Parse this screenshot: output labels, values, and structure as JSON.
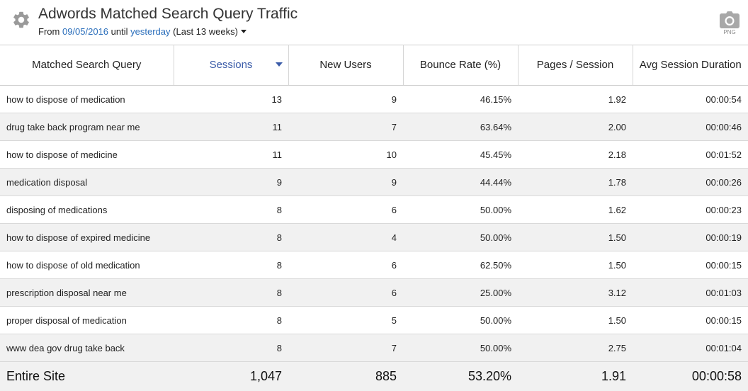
{
  "header": {
    "title": "Adwords Matched Search Query Traffic",
    "from_label": "From",
    "start_date": "09/05/2016",
    "until_label": "until",
    "end_date": "yesterday",
    "period": "(Last 13 weeks)",
    "export_label": "PNG"
  },
  "icons": {
    "settings": "gear-icon",
    "export": "camera-icon",
    "sort": "sort-desc-icon",
    "period": "caret-down-icon"
  },
  "colors": {
    "link": "#2a6ebb",
    "sorted_header": "#3a5ba8",
    "row_alt": "#f1f1f1"
  },
  "table": {
    "columns": [
      "Matched Search Query",
      "Sessions",
      "New Users",
      "Bounce Rate (%)",
      "Pages / Session",
      "Avg Session Duration"
    ],
    "sorted_column": "Sessions",
    "rows": [
      [
        "how to dispose of medication",
        "13",
        "9",
        "46.15%",
        "1.92",
        "00:00:54"
      ],
      [
        "drug take back program near me",
        "11",
        "7",
        "63.64%",
        "2.00",
        "00:00:46"
      ],
      [
        "how to dispose of medicine",
        "11",
        "10",
        "45.45%",
        "2.18",
        "00:01:52"
      ],
      [
        "medication disposal",
        "9",
        "9",
        "44.44%",
        "1.78",
        "00:00:26"
      ],
      [
        "disposing of medications",
        "8",
        "6",
        "50.00%",
        "1.62",
        "00:00:23"
      ],
      [
        "how to dispose of expired medicine",
        "8",
        "4",
        "50.00%",
        "1.50",
        "00:00:19"
      ],
      [
        "how to dispose of old medication",
        "8",
        "6",
        "62.50%",
        "1.50",
        "00:00:15"
      ],
      [
        "prescription disposal near me",
        "8",
        "6",
        "25.00%",
        "3.12",
        "00:01:03"
      ],
      [
        "proper disposal of medication",
        "8",
        "5",
        "50.00%",
        "1.50",
        "00:00:15"
      ],
      [
        "www dea gov drug take back",
        "8",
        "7",
        "50.00%",
        "2.75",
        "00:01:04"
      ]
    ],
    "totals": [
      "Entire Site",
      "1,047",
      "885",
      "53.20%",
      "1.91",
      "00:00:58"
    ]
  }
}
